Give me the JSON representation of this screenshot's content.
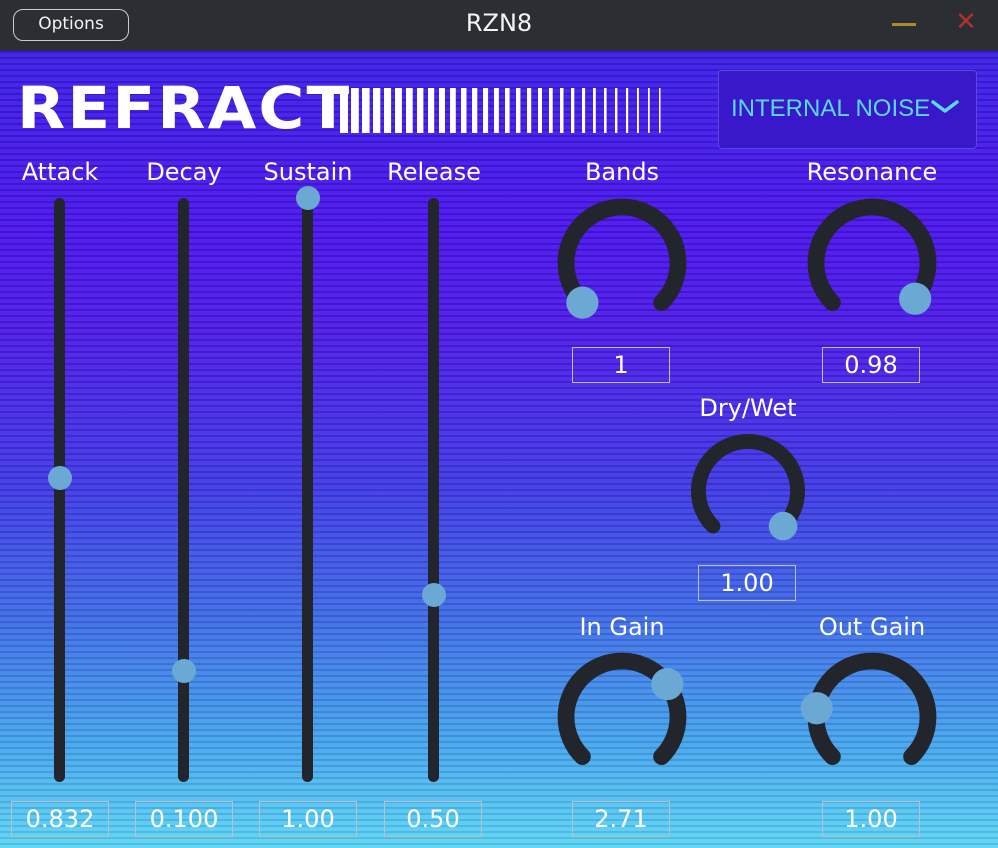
{
  "window": {
    "title": "RZN8",
    "options_label": "Options"
  },
  "colors": {
    "accent": "#6ba9d4",
    "track": "#22252b",
    "noise_text": "#59d9ee",
    "min": "#b08a2e",
    "close": "#b0302a"
  },
  "icons": {
    "minimize": "minimize-icon",
    "close": "close-icon",
    "dropdown": "chevron-down-icon"
  },
  "logo": {
    "text": "REFRACT"
  },
  "noise": {
    "selected": "INTERNAL NOISE"
  },
  "sliders": [
    {
      "label": "Attack",
      "display": "0.832",
      "level": 0.52
    },
    {
      "label": "Decay",
      "display": "0.100",
      "level": 0.19
    },
    {
      "label": "Sustain",
      "display": "1.00",
      "level": 1.0
    },
    {
      "label": "Release",
      "display": "0.50",
      "level": 0.32
    }
  ],
  "knobs": {
    "bands": {
      "label": "Bands",
      "display": "1",
      "level": 0.0
    },
    "resonance": {
      "label": "Resonance",
      "display": "0.98",
      "level": 0.98
    },
    "drywet": {
      "label": "Dry/Wet",
      "display": "1.00",
      "level": 1.0
    },
    "ingain": {
      "label": "In Gain",
      "display": "2.71",
      "level": 0.7
    },
    "outgain": {
      "label": "Out Gain",
      "display": "1.00",
      "level": 0.2
    }
  }
}
